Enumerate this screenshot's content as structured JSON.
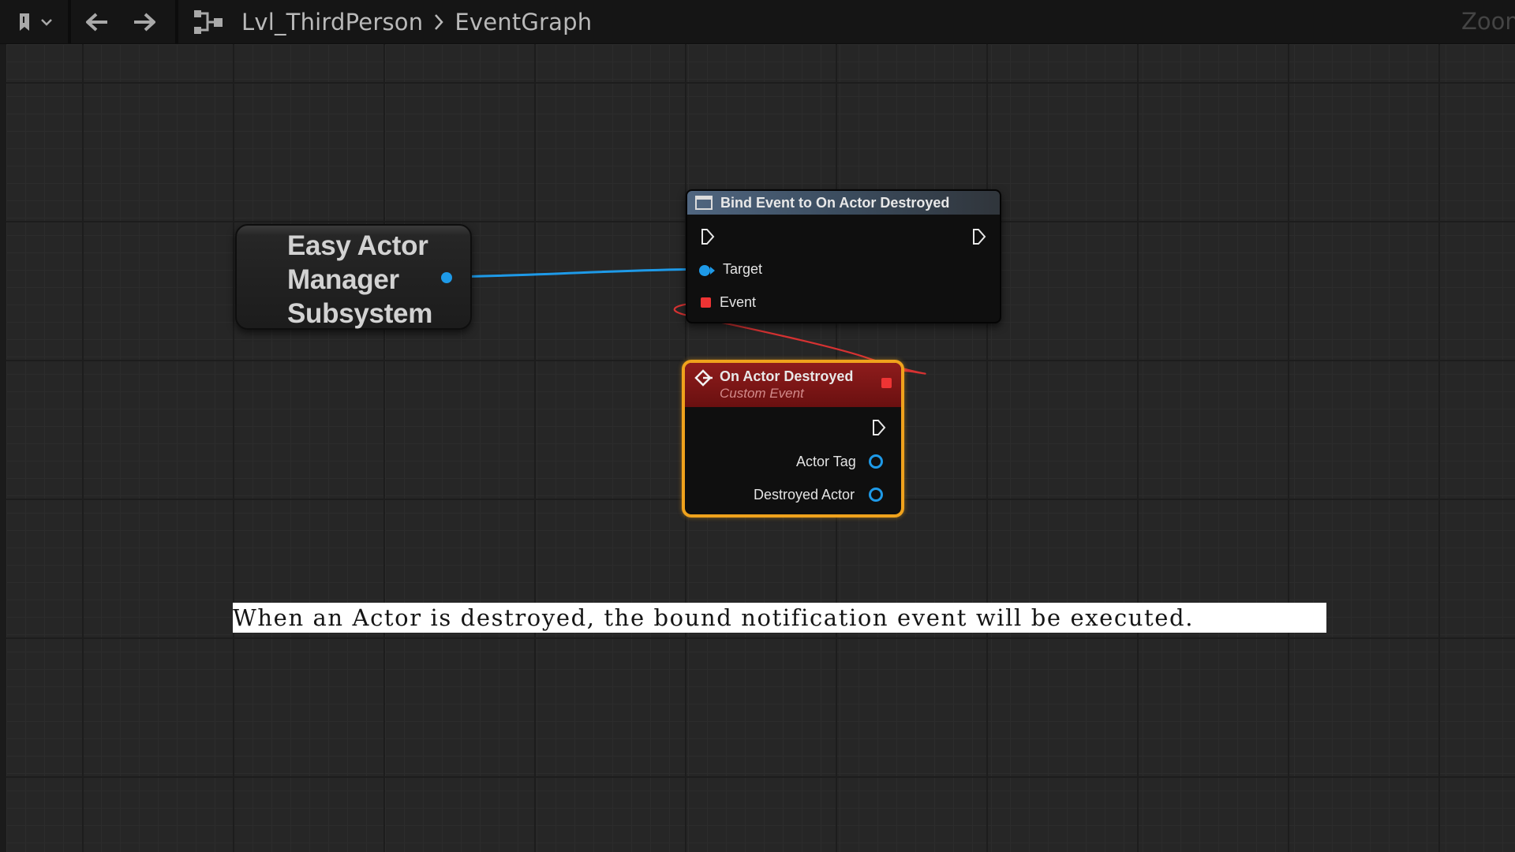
{
  "toolbar": {
    "bookmark_icon": "bookmark-icon",
    "back_icon": "arrow-left-icon",
    "forward_icon": "arrow-right-icon",
    "graph_icon": "blueprint-graph-icon",
    "breadcrumb": [
      "Lvl_ThirdPerson",
      "EventGraph"
    ],
    "zoom_label": "Zoom"
  },
  "graph": {
    "subsystem_node": {
      "title": "Easy Actor\nManager\nSubsystem"
    },
    "bind_node": {
      "title": "Bind Event to On Actor Destroyed",
      "pins": {
        "target": "Target",
        "event": "Event"
      }
    },
    "event_node": {
      "title": "On Actor Destroyed",
      "subtitle": "Custom Event",
      "pins": {
        "actor_tag": "Actor Tag",
        "destroyed_actor": "Destroyed Actor"
      }
    }
  },
  "caption": "When an Actor is destroyed, the bound notification event will be executed.",
  "colors": {
    "object_pin": "#1e9ae8",
    "delegate_pin": "#ee3434",
    "selection_outline": "#f0a21c",
    "function_header": "#506680",
    "event_header": "#8e1c1c"
  }
}
